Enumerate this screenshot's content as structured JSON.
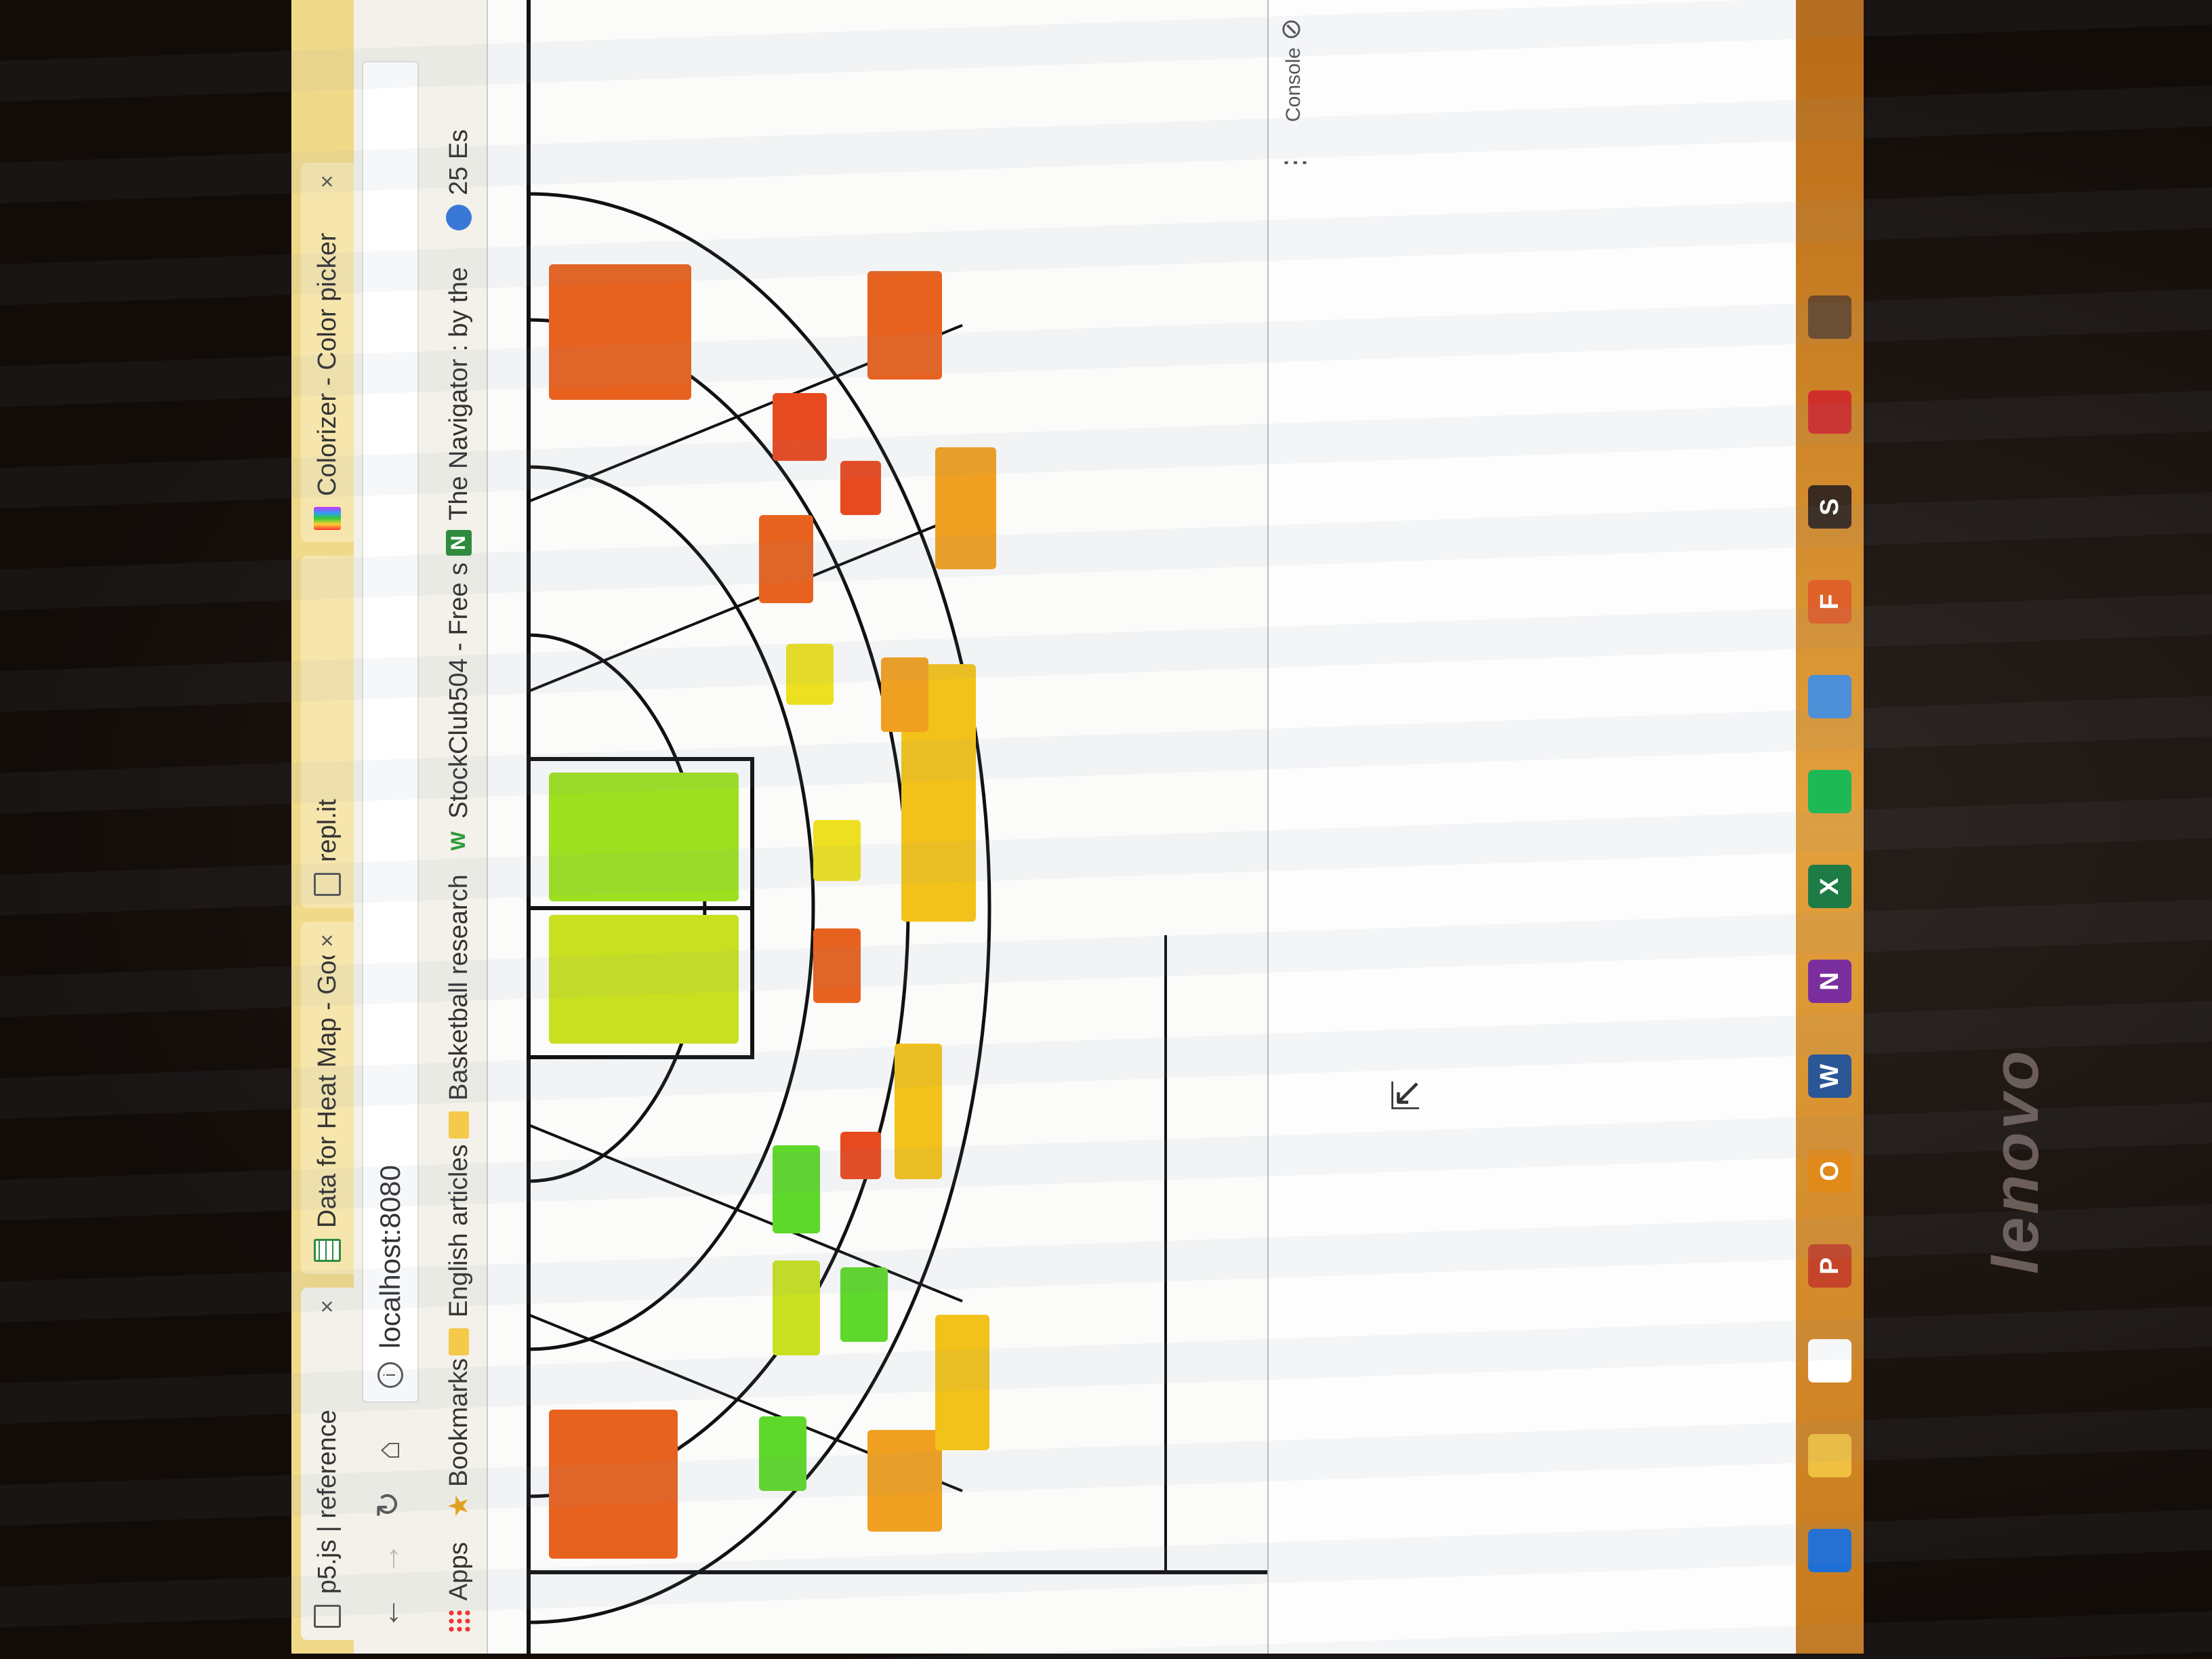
{
  "tabs": [
    {
      "title": "p5.js | reference",
      "icon": "page-icon",
      "close": "×",
      "active": true
    },
    {
      "title": "Data for Heat Map - Goo",
      "icon": "sheets-icon",
      "close": "×",
      "active": false
    },
    {
      "title": "repl.it",
      "icon": "page-icon",
      "close": "",
      "active": false
    },
    {
      "title": "Colorizer - Color picker",
      "icon": "rainbow-icon",
      "close": "×",
      "active": false
    }
  ],
  "toolbar": {
    "back": "←",
    "forward": "→",
    "reload": "↻",
    "home": "⌂",
    "url": "localhost:8080",
    "info": "i"
  },
  "bookmarks": [
    {
      "label": "Apps",
      "icon": "apps-icon"
    },
    {
      "label": "Bookmarks",
      "icon": "star-icon"
    },
    {
      "label": "English articles",
      "icon": "folder-icon"
    },
    {
      "label": "Basketball research",
      "icon": "folder-icon"
    },
    {
      "label": "StockClub504 - Free s",
      "icon": "w-icon"
    },
    {
      "label": "The Navigator : by the",
      "icon": "n-icon"
    },
    {
      "label": "25 Es",
      "icon": "circle-icon"
    }
  ],
  "devtools": {
    "console_tab": "Console",
    "more": "⋮"
  },
  "heatmap": {
    "colors": {
      "orange": "#e8621f",
      "red_orange": "#e84a1f",
      "amber": "#f0a020",
      "gold": "#f2c21a",
      "yellow": "#ece020",
      "lime": "#c8e020",
      "light_green": "#9ee020",
      "green": "#5ed82a",
      "outline": "#111111"
    }
  },
  "taskbar": [
    {
      "name": "windows-start-icon",
      "label": ""
    },
    {
      "name": "file-explorer-icon",
      "label": ""
    },
    {
      "name": "chrome-icon",
      "label": ""
    },
    {
      "name": "powerpoint-icon",
      "label": "P"
    },
    {
      "name": "outlook-icon",
      "label": "O"
    },
    {
      "name": "word-icon",
      "label": "W"
    },
    {
      "name": "onenote-icon",
      "label": "N"
    },
    {
      "name": "excel-icon",
      "label": "X"
    },
    {
      "name": "spotify-icon",
      "label": ""
    },
    {
      "name": "photos-icon",
      "label": ""
    },
    {
      "name": "foxit-icon",
      "label": "F"
    },
    {
      "name": "s-app-icon",
      "label": "S"
    },
    {
      "name": "red-app-icon",
      "label": ""
    },
    {
      "name": "game-icon",
      "label": ""
    }
  ],
  "brand": "lenovo"
}
